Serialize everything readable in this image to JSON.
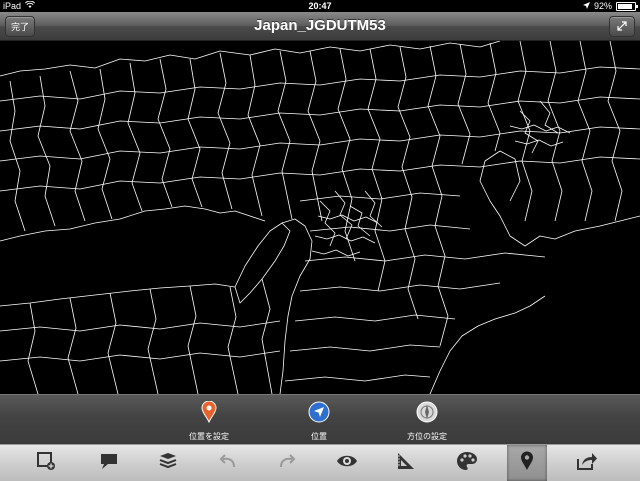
{
  "status": {
    "device": "iPad",
    "time": "20:47",
    "battery": "92%"
  },
  "navbar": {
    "title": "Japan_JGDUTM53",
    "done_label": "完了"
  },
  "info_actions": [
    {
      "label": "位置を設定",
      "icon": "map-pin-icon"
    },
    {
      "label": "位置",
      "icon": "locate-arrow-icon"
    },
    {
      "label": "方位の設定",
      "icon": "compass-icon"
    }
  ],
  "toolbar": [
    {
      "icon": "edit-layer-icon"
    },
    {
      "icon": "comment-icon"
    },
    {
      "icon": "layers-icon"
    },
    {
      "icon": "undo-icon"
    },
    {
      "icon": "redo-icon"
    },
    {
      "icon": "eye-icon"
    },
    {
      "icon": "ruler-triangle-icon"
    },
    {
      "icon": "palette-icon"
    },
    {
      "icon": "location-pin-icon",
      "active": true
    },
    {
      "icon": "share-icon"
    }
  ],
  "colors": {
    "map_background": "#000000",
    "boundary_lines": "#ffffff",
    "pin_orange": "#e8622c",
    "locate_blue": "#2f6fd0"
  }
}
